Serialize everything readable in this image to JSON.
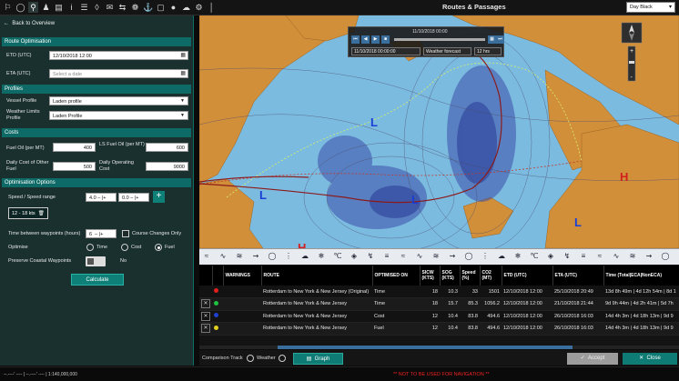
{
  "app": {
    "title": "Routes & Passages",
    "theme": "Day Black"
  },
  "toolbar": {
    "icons": [
      "bell-icon",
      "world-icon",
      "route-icon",
      "people-icon",
      "chart-icon",
      "info-icon",
      "list-icon",
      "layers-icon",
      "envelope-icon",
      "arrows-icon",
      "wheel-icon",
      "anchor-icon",
      "box-icon",
      "droplet-icon",
      "cloud-icon",
      "settings-icon",
      "ruler-icon"
    ]
  },
  "left": {
    "back": "Back to Overview",
    "route_opt": {
      "title": "Route Optimisation",
      "etd_label": "ETD   (UTC)",
      "etd_value": "12/10/2018 12:00",
      "eta_label": "ETA   (UTC)",
      "eta_placeholder": "Select a date"
    },
    "profiles": {
      "title": "Profiles",
      "vessel_label": "Vessel Profile",
      "vessel_value": "Laden profile",
      "weather_label": "Weather Limits Profile",
      "weather_value": "Laden Profile"
    },
    "costs": {
      "title": "Costs",
      "fuel_oil_label": "Fuel Oil (per MT)",
      "fuel_oil_value": "400",
      "ls_fuel_label": "LS Fuel Oil (per MT)",
      "ls_fuel_value": "600",
      "daily_other_label": "Daily Cost of Other Fuel",
      "daily_other_value": "500",
      "daily_op_label": "Daily Operating Cost",
      "daily_op_value": "9000"
    },
    "options": {
      "title": "Optimisation Options",
      "speed_label": "Speed / Speed range",
      "speed_min": "4.0",
      "speed_max": "0.0",
      "range_tag": "12 - 18 kts",
      "time_between_label": "Time between waypoints (hours)",
      "time_between_value": "6",
      "course_changes_label": "Course Changes Only",
      "optimise_label": "Optimise",
      "opt_time": "Time",
      "opt_cost": "Cost",
      "opt_fuel": "Fuel",
      "preserve_label": "Preserve Coastal Waypoints",
      "preserve_value": "No",
      "calculate": "Calculate"
    }
  },
  "map": {
    "playbar_date_top": "11/10/2018 00:00",
    "playbar_date_sel": "11/10/2018 00:00:00",
    "forecast_sel": "Weather forecast",
    "step_sel": "12 hrs",
    "pressure_labels": [
      "L",
      "L",
      "L",
      "L",
      "H",
      "H",
      "L"
    ]
  },
  "table": {
    "headers": [
      "",
      "",
      "WARNINGS",
      "ROUTE",
      "OPTIMISED ON",
      "SICW (KTS)",
      "SOG (KTS)",
      "Speed (%)",
      "CO2 (MT)",
      "ETD (UTC)",
      "ETA (UTC)",
      "Time (Total|ECA|NonECA)"
    ],
    "rows": [
      {
        "color": "#e02020",
        "route": "Rotterdam to New York & New Jersey (Original)",
        "opt": "Time",
        "sicw": "18",
        "sog": "10.3",
        "speed": "33",
        "co2": "1501",
        "etd": "12/10/2018 12:00",
        "eta": "25/10/2018 20:49",
        "time": "13d 8h 49m | 4d 12h 54m | 8d 1",
        "trash": false
      },
      {
        "color": "#20c040",
        "route": "Rotterdam to New York & New Jersey",
        "opt": "Time",
        "sicw": "18",
        "sog": "15.7",
        "speed": "85.3",
        "co2": "1056.2",
        "etd": "12/10/2018 12:00",
        "eta": "21/10/2018 21:44",
        "time": "9d 9h 44m | 4d 2h 41m | 5d 7h",
        "trash": true
      },
      {
        "color": "#2040d0",
        "route": "Rotterdam to New York & New Jersey",
        "opt": "Cost",
        "sicw": "12",
        "sog": "10.4",
        "speed": "83.8",
        "co2": "494.6",
        "etd": "12/10/2018 12:00",
        "eta": "26/10/2018 16:03",
        "time": "14d 4h 3m | 4d 18h 13m | 9d 9",
        "trash": true
      },
      {
        "color": "#e0d020",
        "route": "Rotterdam to New York & New Jersey",
        "opt": "Fuel",
        "sicw": "12",
        "sog": "10.4",
        "speed": "83.8",
        "co2": "494.6",
        "etd": "12/10/2018 12:00",
        "eta": "26/10/2018 16:03",
        "time": "14d 4h 3m | 4d 18h 13m | 9d 9",
        "trash": true
      }
    ]
  },
  "bottom": {
    "comparison": "Comparison Track",
    "weather": "Weather",
    "graph": "Graph",
    "accept": "Accept",
    "close": "Close"
  },
  "status": {
    "scale": "--.----' ---- | --.----' ---- | 1:140,000,000",
    "warning": "** NOT TO BE USED FOR NAVIGATION **"
  }
}
